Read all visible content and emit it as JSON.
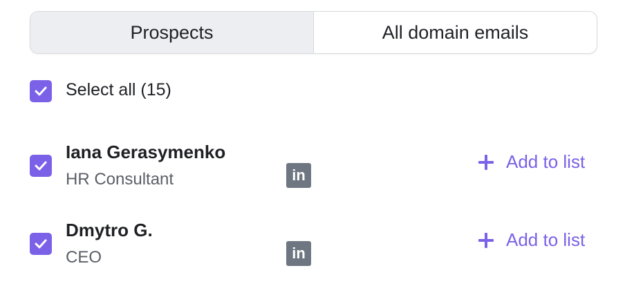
{
  "tabs": [
    {
      "label": "Prospects",
      "active": true
    },
    {
      "label": "All domain emails",
      "active": false
    }
  ],
  "select_all": {
    "label": "Select all (15)",
    "checked": true
  },
  "prospects": [
    {
      "name": "Iana Gerasymenko",
      "title": "HR Consultant",
      "linkedin_label": "in",
      "checked": true,
      "action_label": "Add to list"
    },
    {
      "name": "Dmytro G.",
      "title": "CEO",
      "linkedin_label": "in",
      "checked": true,
      "action_label": "Add to list"
    }
  ],
  "colors": {
    "accent": "#7b61e8",
    "linkedin_bg": "#6e7681",
    "active_tab_bg": "#eceef2"
  }
}
